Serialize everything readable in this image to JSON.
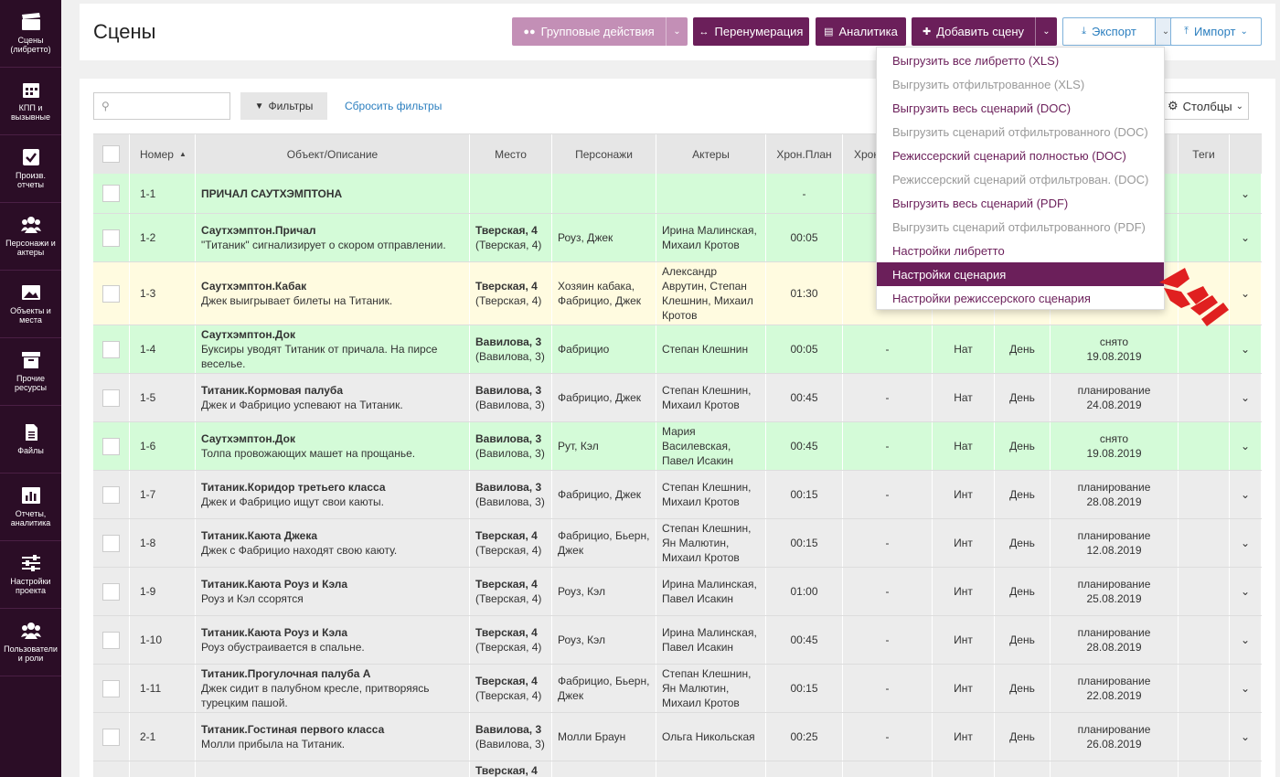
{
  "sidebar": {
    "items": [
      {
        "label": "Сцены (либретто)",
        "icon": "clapper-icon"
      },
      {
        "label": "КПП и вызывные",
        "icon": "calendar-icon"
      },
      {
        "label": "Произв. отчеты",
        "icon": "checkbox-icon"
      },
      {
        "label": "Персонажи и актеры",
        "icon": "people-icon"
      },
      {
        "label": "Объекты и места",
        "icon": "image-icon"
      },
      {
        "label": "Прочие ресурсы",
        "icon": "box-icon"
      },
      {
        "label": "Файлы",
        "icon": "file-icon"
      },
      {
        "label": "Отчеты, аналитика",
        "icon": "chart-icon"
      },
      {
        "label": "Настройки проекта",
        "icon": "sliders-icon"
      },
      {
        "label": "Пользователи и роли",
        "icon": "users-icon"
      }
    ]
  },
  "header": {
    "title": "Сцены",
    "group_actions": "Групповые действия",
    "renumber": "Перенумерация",
    "analytics": "Аналитика",
    "add_scene": "Добавить сцену",
    "export": "Экспорт",
    "import": "Импорт"
  },
  "toolbar": {
    "search_placeholder": "",
    "filters": "Фильтры",
    "reset_filters": "Сбросить фильтры",
    "columns": "Столбцы"
  },
  "table": {
    "headers": {
      "number": "Номер",
      "object": "Объект/Описание",
      "place": "Место",
      "characters": "Персонажи",
      "actors": "Актеры",
      "chron_plan": "Хрон.План",
      "chron_fact": "Хрон",
      "tags": "Теги"
    },
    "rows": [
      {
        "num": "1-1",
        "title": "ПРИЧАЛ САУТХЭМПТОНА",
        "desc": "",
        "place_b": "",
        "place": "",
        "chars": "",
        "actors": "",
        "plan": "-",
        "fact": "",
        "io": "",
        "dn": "",
        "status": "",
        "date": ""
      },
      {
        "num": "1-2",
        "title": "Саутхэмптон.Причал",
        "desc": "\"Титаник\" сигнализирует о скором отправлении.",
        "place_b": "Тверская, 4",
        "place": "(Тверская, 4)",
        "chars": "Роуз, Джек",
        "actors": "Ирина Малинская, Михаил Кротов",
        "plan": "00:05",
        "fact": "",
        "io": "",
        "dn": "",
        "status": "",
        "date": ""
      },
      {
        "num": "1-3",
        "title": "Саутхэмптон.Кабак",
        "desc": "Джек выигрывает билеты на Титаник.",
        "place_b": "Тверская, 4",
        "place": "(Тверская, 4)",
        "chars": "Хозяин кабака, Фабрицио, Джек",
        "actors": "Александр Аврутин, Степан Клешнин, Михаил Кротов",
        "plan": "01:30",
        "fact": "",
        "io": "",
        "dn": "",
        "status": "",
        "date": ""
      },
      {
        "num": "1-4",
        "title": "Саутхэмптон.Док",
        "desc": "Буксиры уводят Титаник от причала. На пирсе веселье.",
        "place_b": "Вавилова, 3",
        "place": "(Вавилова, 3)",
        "chars": "Фабрицио",
        "actors": "Степан Клешнин",
        "plan": "00:05",
        "fact": "-",
        "io": "Нат",
        "dn": "День",
        "status": "снято",
        "date": "19.08.2019"
      },
      {
        "num": "1-5",
        "title": "Титаник.Кормовая палуба",
        "desc": "Джек и Фабрицио успевают на Титаник.",
        "place_b": "Вавилова, 3",
        "place": "(Вавилова, 3)",
        "chars": "Фабрицио, Джек",
        "actors": "Степан Клешнин, Михаил Кротов",
        "plan": "00:45",
        "fact": "-",
        "io": "Нат",
        "dn": "День",
        "status": "планирование",
        "date": "24.08.2019"
      },
      {
        "num": "1-6",
        "title": "Саутхэмптон.Док",
        "desc": "Толпа провожающих машет на прощанье.",
        "place_b": "Вавилова, 3",
        "place": "(Вавилова, 3)",
        "chars": "Рут, Кэл",
        "actors": "Мария Василевская, Павел Исакин",
        "plan": "00:45",
        "fact": "-",
        "io": "Нат",
        "dn": "День",
        "status": "снято",
        "date": "19.08.2019"
      },
      {
        "num": "1-7",
        "title": "Титаник.Коридор третьего класса",
        "desc": "Джек и Фабрицио ищут свои каюты.",
        "place_b": "Вавилова, 3",
        "place": "(Вавилова, 3)",
        "chars": "Фабрицио, Джек",
        "actors": "Степан Клешнин, Михаил Кротов",
        "plan": "00:15",
        "fact": "-",
        "io": "Инт",
        "dn": "День",
        "status": "планирование",
        "date": "28.08.2019"
      },
      {
        "num": "1-8",
        "title": "Титаник.Каюта Джека",
        "desc": "Джек с Фабрицио находят свою каюту.",
        "place_b": "Тверская, 4",
        "place": "(Тверская, 4)",
        "chars": "Фабрицио, Бьерн, Джек",
        "actors": "Степан Клешнин, Ян Малютин, Михаил Кротов",
        "plan": "00:15",
        "fact": "-",
        "io": "Инт",
        "dn": "День",
        "status": "планирование",
        "date": "12.08.2019"
      },
      {
        "num": "1-9",
        "title": "Титаник.Каюта Роуз и Кэла",
        "desc": "Роуз и Кэл ссорятся",
        "place_b": "Тверская, 4",
        "place": "(Тверская, 4)",
        "chars": "Роуз, Кэл",
        "actors": "Ирина Малинская, Павел Исакин",
        "plan": "01:00",
        "fact": "-",
        "io": "Инт",
        "dn": "День",
        "status": "планирование",
        "date": "25.08.2019"
      },
      {
        "num": "1-10",
        "title": "Титаник.Каюта Роуз и Кэла",
        "desc": "Роуз обустраивается в спальне.",
        "place_b": "Тверская, 4",
        "place": "(Тверская, 4)",
        "chars": "Роуз, Кэл",
        "actors": "Ирина Малинская, Павел Исакин",
        "plan": "00:45",
        "fact": "-",
        "io": "Инт",
        "dn": "День",
        "status": "планирование",
        "date": "28.08.2019"
      },
      {
        "num": "1-11",
        "title": "Титаник.Прогулочная палуба А",
        "desc": "Джек сидит в палубном кресле, притворяясь турецким пашой.",
        "place_b": "Тверская, 4",
        "place": "(Тверская, 4)",
        "chars": "Фабрицио, Бьерн, Джек",
        "actors": "Степан Клешнин, Ян Малютин, Михаил Кротов",
        "plan": "00:15",
        "fact": "-",
        "io": "Инт",
        "dn": "День",
        "status": "планирование",
        "date": "22.08.2019"
      },
      {
        "num": "2-1",
        "title": "Титаник.Гостиная первого класса",
        "desc": "Молли прибыла на Титаник.",
        "place_b": "Вавилова, 3",
        "place": "(Вавилова, 3)",
        "chars": "Молли Браун",
        "actors": "Ольга Никольская",
        "plan": "00:25",
        "fact": "-",
        "io": "Инт",
        "dn": "День",
        "status": "планирование",
        "date": "26.08.2019"
      }
    ],
    "partial_row": {
      "place_b": "Тверская, 4"
    }
  },
  "export_menu": {
    "items": [
      {
        "label": "Выгрузить все либретто (XLS)",
        "state": "normal"
      },
      {
        "label": "Выгрузить отфильтрованное (XLS)",
        "state": "disabled"
      },
      {
        "label": "Выгрузить весь сценарий (DOC)",
        "state": "normal"
      },
      {
        "label": "Выгрузить сценарий отфильтрованного (DOC)",
        "state": "disabled"
      },
      {
        "label": "Режиссерский сценарий полностью (DOC)",
        "state": "normal"
      },
      {
        "label": "Режиссерский сценарий отфильтрован. (DOC)",
        "state": "disabled"
      },
      {
        "label": "Выгрузить весь сценарий (PDF)",
        "state": "normal"
      },
      {
        "label": "Выгрузить сценарий отфильтрованного (PDF)",
        "state": "disabled"
      },
      {
        "label": "Настройки либретто",
        "state": "normal"
      },
      {
        "label": "Настройки сценария",
        "state": "active"
      },
      {
        "label": "Настройки режиссерского сценария",
        "state": "normal"
      }
    ]
  },
  "colors": {
    "brand": "#6b1f5a",
    "sidebar": "#2b0d26",
    "row_green": "#d4fbd8",
    "row_yellow": "#fffbe0",
    "row_grey": "#ececec",
    "pointer": "#e02020"
  }
}
